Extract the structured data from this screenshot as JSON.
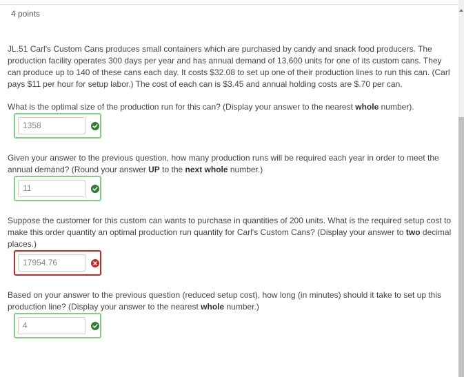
{
  "header": {
    "points": "4 points"
  },
  "problem": {
    "text": "JL.51 Carl's Custom Cans produces small containers which are purchased by candy and snack food producers. The production facility operates 300 days per year and has annual demand of 13,600 units for one of its custom cans. They can produce up to 140 of these cans each day. It costs $32.08 to set up one of their production lines to run this can. (Carl pays $11 per hour for setup labor.) The cost of each can is $3.45 and annual holding costs are $.70 per can."
  },
  "questions": [
    {
      "pre": "What is the optimal size of the production run for this can? (Display your answer to the nearest ",
      "bold1": "whole",
      "post": " number).",
      "answer": "1358",
      "status": "correct"
    },
    {
      "pre": "Given your answer to the previous question, how many production runs will be required each year in order to meet the annual demand? (Round your answer ",
      "bold1": "UP",
      "mid": " to the ",
      "bold2": "next whole",
      "post": " number.)",
      "answer": "11",
      "status": "correct"
    },
    {
      "pre": "Suppose the customer for this custom can wants to purchase in quantities of 200 units. What is the required setup cost to make this order quantity an optimal production run quantity for Carl's Custom Cans? (Display your answer to ",
      "bold1": "two",
      "post": " decimal places.)",
      "answer": "17954.76",
      "status": "incorrect"
    },
    {
      "pre": "Based on your answer to the previous question (reduced setup cost), how long (in minutes) should it take to set up this production line? (Display your answer to the nearest ",
      "bold1": "whole",
      "post": " number.)",
      "answer": "4",
      "status": "correct"
    }
  ],
  "colors": {
    "correct": "#2e7d32",
    "correct_border": "#7fd27f",
    "incorrect": "#c62828"
  }
}
